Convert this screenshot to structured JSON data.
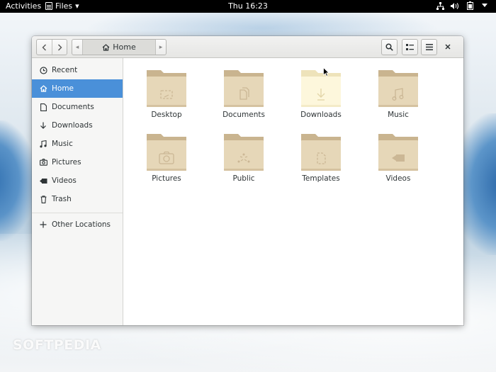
{
  "topbar": {
    "activities": "Activities",
    "app_name": "Files",
    "clock": "Thu 16:23",
    "tray_icons": [
      "network-icon",
      "volume-icon",
      "battery-icon",
      "power-menu-icon"
    ]
  },
  "toolbar": {
    "back_icon": "chevron-left-icon",
    "forward_icon": "chevron-right-icon",
    "path_home": "Home",
    "search_icon": "search-icon",
    "view_icon": "list-view-icon",
    "menu_icon": "hamburger-icon",
    "close_icon": "close-icon"
  },
  "sidebar": {
    "items": [
      {
        "label": "Recent",
        "icon": "clock-icon"
      },
      {
        "label": "Home",
        "icon": "home-icon"
      },
      {
        "label": "Documents",
        "icon": "document-icon"
      },
      {
        "label": "Downloads",
        "icon": "download-icon"
      },
      {
        "label": "Music",
        "icon": "music-icon"
      },
      {
        "label": "Pictures",
        "icon": "camera-icon"
      },
      {
        "label": "Videos",
        "icon": "video-icon"
      },
      {
        "label": "Trash",
        "icon": "trash-icon"
      }
    ],
    "other": {
      "label": "Other Locations",
      "icon": "plus-icon"
    }
  },
  "folders": [
    {
      "label": "Desktop",
      "glyph": "desktop-glyph"
    },
    {
      "label": "Documents",
      "glyph": "documents-glyph"
    },
    {
      "label": "Downloads",
      "glyph": "download-glyph"
    },
    {
      "label": "Music",
      "glyph": "music-glyph"
    },
    {
      "label": "Pictures",
      "glyph": "camera-glyph"
    },
    {
      "label": "Public",
      "glyph": "share-glyph"
    },
    {
      "label": "Templates",
      "glyph": "template-glyph"
    },
    {
      "label": "Videos",
      "glyph": "video-glyph"
    }
  ],
  "colors": {
    "accent": "#4a90d9",
    "folder_tab": "#c9b48f",
    "folder_body": "#e6d7b8",
    "folder_hover": "#fdf7dc"
  },
  "watermark": "SOFTPEDIA"
}
